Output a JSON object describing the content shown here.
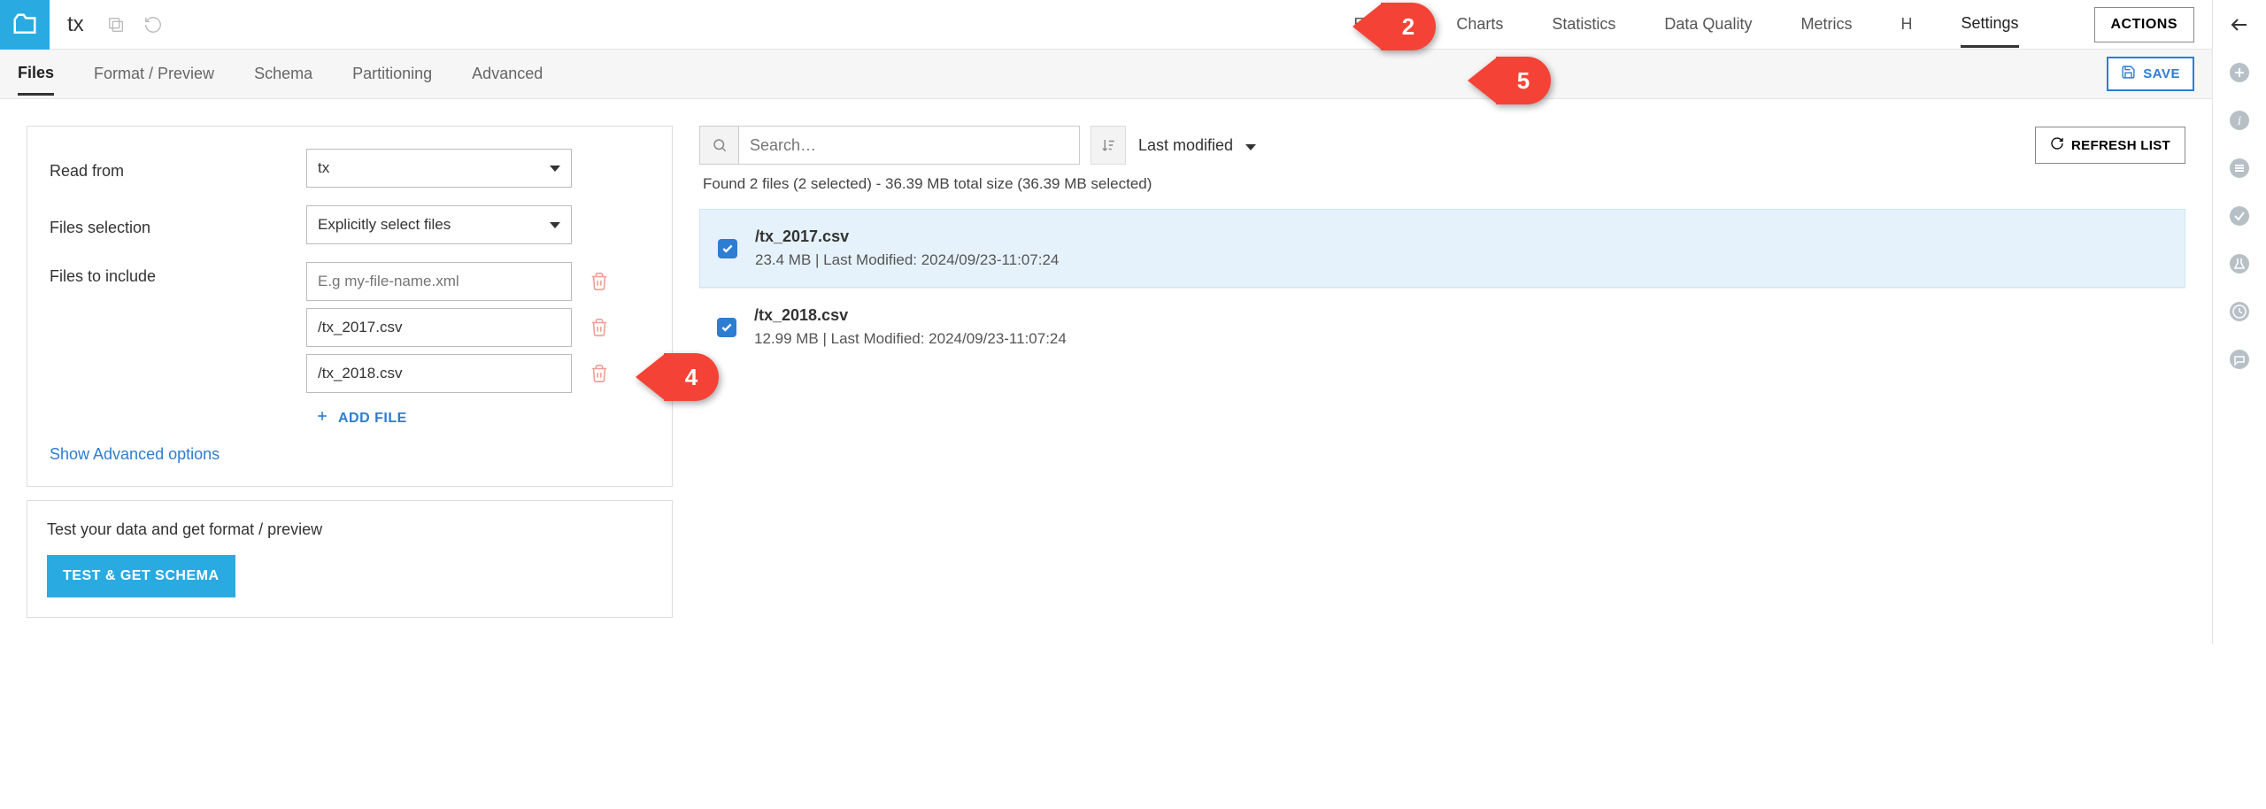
{
  "header": {
    "title": "tx",
    "nav": {
      "explore": "Explore",
      "charts": "Charts",
      "statistics": "Statistics",
      "data_quality": "Data Quality",
      "metrics": "Metrics",
      "history_prefix": "H",
      "settings": "Settings"
    },
    "actions_btn": "ACTIONS"
  },
  "subtabs": {
    "files": "Files",
    "format": "Format / Preview",
    "schema": "Schema",
    "partitioning": "Partitioning",
    "advanced": "Advanced",
    "save": "SAVE"
  },
  "form": {
    "read_from_label": "Read from",
    "read_from_value": "tx",
    "files_selection_label": "Files selection",
    "files_selection_value": "Explicitly select files",
    "files_to_include_label": "Files to include",
    "placeholder": "E.g my-file-name.xml",
    "file1": "/tx_2017.csv",
    "file2": "/tx_2018.csv",
    "add_file": "ADD FILE",
    "advanced_link": "Show Advanced options",
    "test_text": "Test your data and get format / preview",
    "test_btn": "TEST & GET SCHEMA"
  },
  "filelist": {
    "search_placeholder": "Search…",
    "sort_label": "Last modified",
    "refresh": "REFRESH LIST",
    "status": "Found 2 files (2 selected) - 36.39 MB total size (36.39 MB selected)",
    "files": [
      {
        "name": "/tx_2017.csv",
        "meta": "23.4 MB | Last Modified: 2024/09/23-11:07:24"
      },
      {
        "name": "/tx_2018.csv",
        "meta": "12.99 MB | Last Modified: 2024/09/23-11:07:24"
      }
    ]
  },
  "callouts": {
    "c2": "2",
    "c4": "4",
    "c5": "5"
  }
}
